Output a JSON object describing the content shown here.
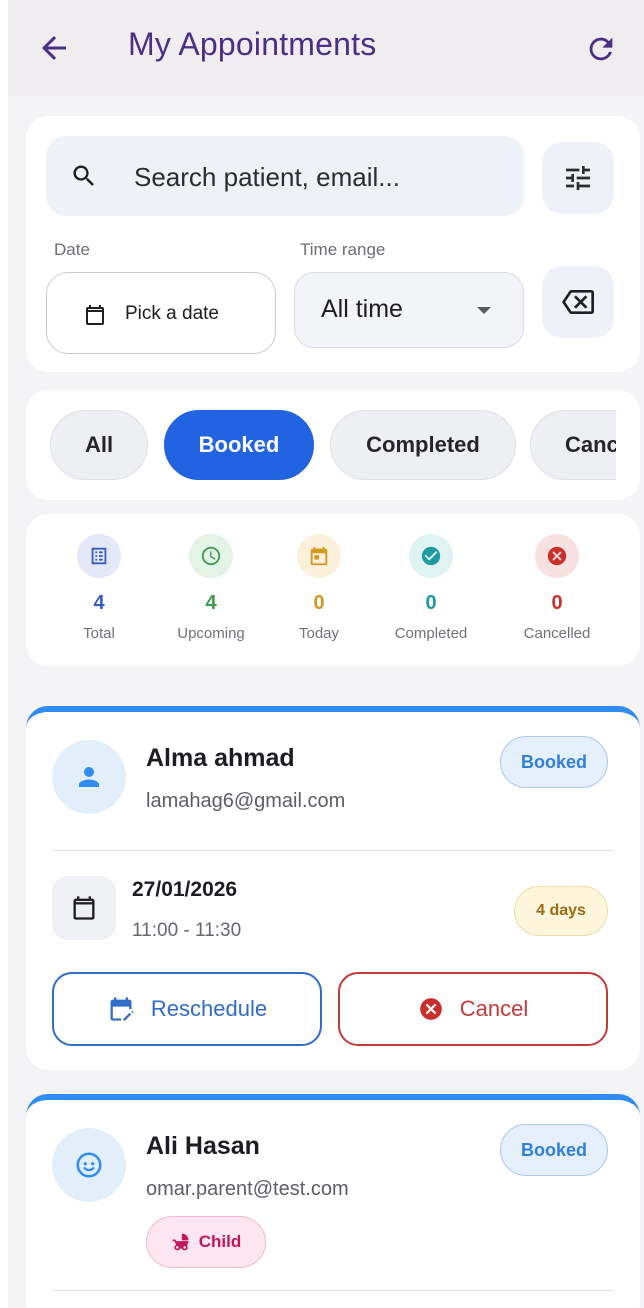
{
  "appbar": {
    "title": "My Appointments",
    "back_icon": "arrow-left-icon",
    "refresh_icon": "refresh-icon"
  },
  "filters": {
    "search_placeholder": "Search patient, email...",
    "date_label": "Date",
    "date_button": "Pick a date",
    "time_range_label": "Time range",
    "time_range_value": "All time"
  },
  "chips": [
    {
      "label": "All",
      "active": false
    },
    {
      "label": "Booked",
      "active": true
    },
    {
      "label": "Completed",
      "active": false
    },
    {
      "label": "Cancelled",
      "active": false,
      "visible_text": "Canc"
    }
  ],
  "stats": [
    {
      "value": "4",
      "label": "Total",
      "color": "#3a5bc7",
      "bg": "#e4e8f8",
      "icon": "list-icon"
    },
    {
      "value": "4",
      "label": "Upcoming",
      "color": "#3d9a4e",
      "bg": "#e3f3e6",
      "icon": "clock-icon"
    },
    {
      "value": "0",
      "label": "Today",
      "color": "#d49a1f",
      "bg": "#fbf0d9",
      "icon": "calendar-today-icon"
    },
    {
      "value": "0",
      "label": "Completed",
      "color": "#1f9aa0",
      "bg": "#dff3f3",
      "icon": "check-circle-icon"
    },
    {
      "value": "0",
      "label": "Cancelled",
      "color": "#c9302c",
      "bg": "#f8e1e1",
      "icon": "cancel-circle-icon"
    }
  ],
  "appointments": [
    {
      "name": "Alma ahmad",
      "email": "lamahag6@gmail.com",
      "status": "Booked",
      "date": "27/01/2026",
      "time": "11:00 - 11:30",
      "countdown": "4 days",
      "reschedule_label": "Reschedule",
      "cancel_label": "Cancel"
    },
    {
      "name": "Ali Hasan",
      "email": "omar.parent@test.com",
      "status": "Booked",
      "tag": "Child"
    }
  ],
  "colors": {
    "accent": "#2163e0",
    "title": "#4a2f86",
    "card_accent": "#2f8cf0"
  }
}
